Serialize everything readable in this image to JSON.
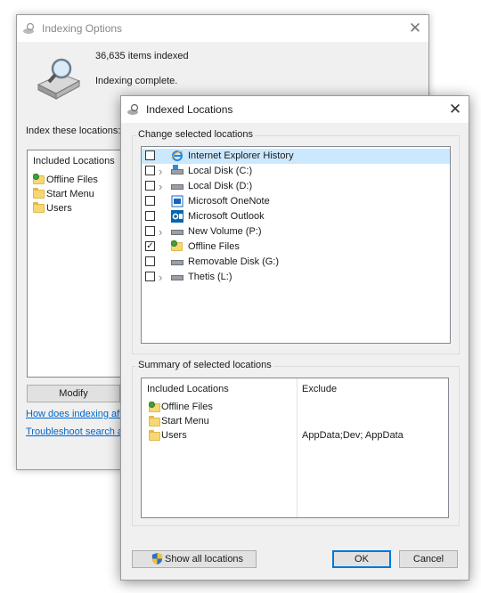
{
  "back_window": {
    "title": "Indexing Options",
    "status_count": "36,635 items indexed",
    "status_message": "Indexing complete.",
    "index_label": "Index these locations:",
    "included_header": "Included Locations",
    "included": [
      "Offline Files",
      "Start Menu",
      "Users"
    ],
    "modify_button": "Modify",
    "link_how": "How does indexing affe",
    "link_troubleshoot": "Troubleshoot search an"
  },
  "front_window": {
    "title": "Indexed Locations",
    "change_group_label": "Change selected locations",
    "locations": [
      {
        "label": "Internet Explorer History",
        "checked": false,
        "expandable": false,
        "icon": "ie-icon",
        "selected": true
      },
      {
        "label": "Local Disk (C:)",
        "checked": false,
        "expandable": true,
        "icon": "system-drive-icon"
      },
      {
        "label": "Local Disk (D:)",
        "checked": false,
        "expandable": true,
        "icon": "drive-icon"
      },
      {
        "label": "Microsoft OneNote",
        "checked": false,
        "expandable": false,
        "icon": "onenote-icon"
      },
      {
        "label": "Microsoft Outlook",
        "checked": false,
        "expandable": false,
        "icon": "outlook-icon"
      },
      {
        "label": "New Volume (P:)",
        "checked": false,
        "expandable": true,
        "icon": "drive-icon"
      },
      {
        "label": "Offline Files",
        "checked": true,
        "expandable": false,
        "icon": "offline-files-icon"
      },
      {
        "label": "Removable Disk (G:)",
        "checked": false,
        "expandable": false,
        "icon": "drive-icon"
      },
      {
        "label": "Thetis (L:)",
        "checked": false,
        "expandable": true,
        "icon": "drive-icon"
      }
    ],
    "summary_group_label": "Summary of selected locations",
    "summary_col_included": "Included Locations",
    "summary_col_exclude": "Exclude",
    "summary_rows": [
      {
        "location": "Offline Files",
        "exclude": ""
      },
      {
        "location": "Start Menu",
        "exclude": ""
      },
      {
        "location": "Users",
        "exclude": "AppData;Dev; AppData"
      }
    ],
    "show_all_button": "Show all locations",
    "ok_button": "OK",
    "cancel_button": "Cancel"
  },
  "colors": {
    "accent": "#0078d7",
    "selection": "#cce8ff",
    "link": "#0066cc"
  }
}
